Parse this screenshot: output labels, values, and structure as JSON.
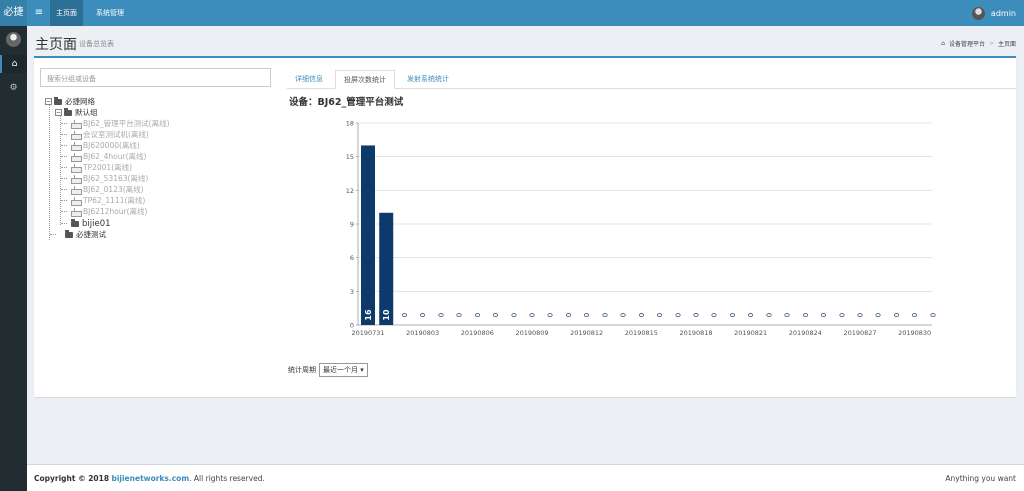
{
  "app": {
    "logo": "必捷",
    "menu_icon": "bars-icon"
  },
  "nav": {
    "items": [
      "主页面",
      "系统管理"
    ],
    "active": 0
  },
  "user": {
    "name": "admin"
  },
  "sidebar": {
    "items": [
      {
        "icon": "home-icon"
      },
      {
        "icon": "gear-icon"
      }
    ]
  },
  "header": {
    "title": "主页面",
    "subtitle": "设备总览表"
  },
  "breadcrumb": {
    "items": [
      "设备管理平台",
      "主页面"
    ]
  },
  "search": {
    "placeholder": "搜索分组或设备"
  },
  "tree": {
    "root": "必捷网络",
    "group": "默认组",
    "devices": [
      "BJ62_管理平台测试(离线)",
      "会议室测试机(离线)",
      "BJ620000(离线)",
      "BJ62_4hour(离线)",
      "TP2001(离线)",
      "BJ62_53163(离线)",
      "BJ62_0123(离线)",
      "TP62_1111(离线)",
      "BJ6212hour(离线)"
    ],
    "subfolder": "bijie01",
    "group2": "必捷测试"
  },
  "tabs": [
    "详细信息",
    "投屏次数统计",
    "发射系统统计"
  ],
  "active_tab": 1,
  "device_title": "设备：BJ62_管理平台测试",
  "chart_data": {
    "type": "bar",
    "y_ticks": [
      0,
      3,
      6,
      9,
      12,
      15,
      18
    ],
    "ylim": [
      0,
      18
    ],
    "x_tick_labels": [
      "20190731",
      "20190803",
      "20190806",
      "20190809",
      "20190812",
      "20190815",
      "20190818",
      "20190821",
      "20190824",
      "20190827",
      "20190830"
    ],
    "categories": [
      "20190731",
      "20190801",
      "20190802",
      "20190803",
      "20190804",
      "20190805",
      "20190806",
      "20190807",
      "20190808",
      "20190809",
      "20190810",
      "20190811",
      "20190812",
      "20190813",
      "20190814",
      "20190815",
      "20190816",
      "20190817",
      "20190818",
      "20190819",
      "20190820",
      "20190821",
      "20190822",
      "20190823",
      "20190824",
      "20190825",
      "20190826",
      "20190827",
      "20190828",
      "20190829",
      "20190830",
      "20190831"
    ],
    "values": [
      16,
      10,
      0,
      0,
      0,
      0,
      0,
      0,
      0,
      0,
      0,
      0,
      0,
      0,
      0,
      0,
      0,
      0,
      0,
      0,
      0,
      0,
      0,
      0,
      0,
      0,
      0,
      0,
      0,
      0,
      0,
      0
    ],
    "bar_color": "#0d3a6b",
    "grid": true
  },
  "period": {
    "label": "统计周期",
    "selected": "最近一个月"
  },
  "footer": {
    "copyright_prefix": "Copyright © 2018",
    "link": "bijienetworks.com",
    "suffix": ". All rights reserved.",
    "right": "Anything you want"
  }
}
